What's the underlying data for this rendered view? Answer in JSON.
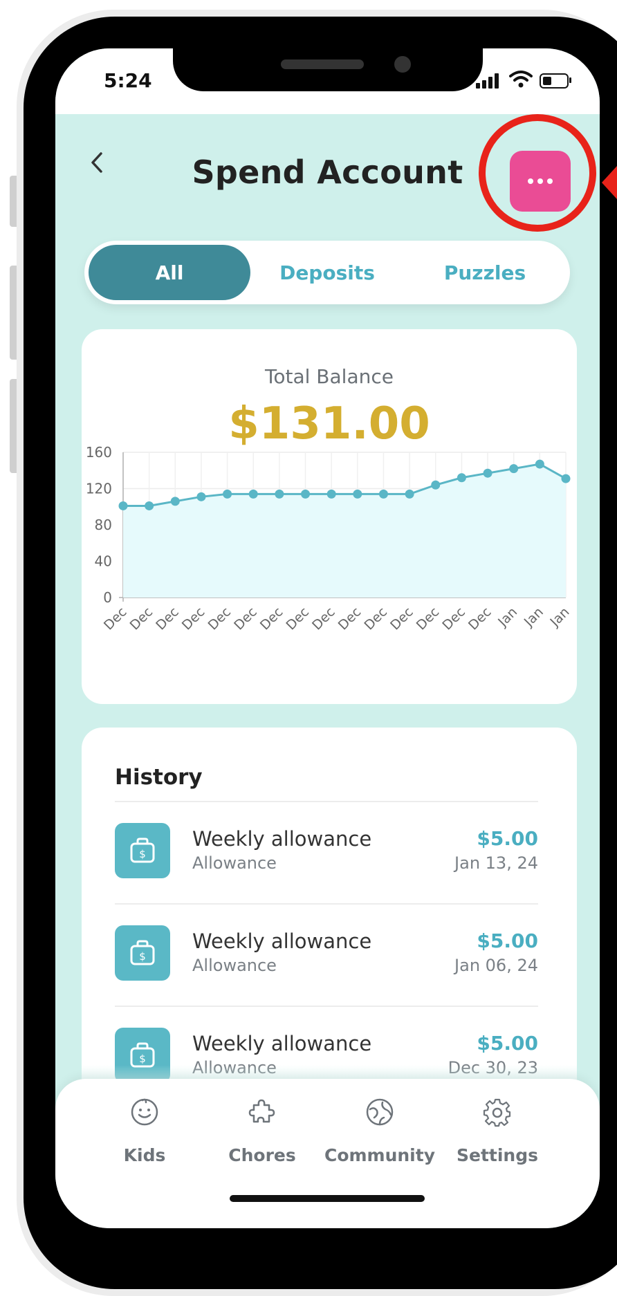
{
  "status": {
    "time": "5:24"
  },
  "header": {
    "title": "Spend Account",
    "back_icon": "chevron-left-icon",
    "more_icon": "ellipsis-icon"
  },
  "filters": {
    "tabs": [
      "All",
      "Deposits",
      "Puzzles"
    ],
    "active": "All"
  },
  "balance": {
    "label": "Total Balance",
    "value": "$131.00"
  },
  "chart_data": {
    "type": "area",
    "x": [
      "Dec",
      "Dec",
      "Dec",
      "Dec",
      "Dec",
      "Dec",
      "Dec",
      "Dec",
      "Dec",
      "Dec",
      "Dec",
      "Dec",
      "Dec",
      "Dec",
      "Dec",
      "Jan",
      "Jan",
      "Jan"
    ],
    "values": [
      101,
      101,
      106,
      111,
      114,
      114,
      114,
      114,
      114,
      114,
      114,
      114,
      124,
      132,
      137,
      142,
      147,
      131
    ],
    "ylim": [
      0,
      160
    ],
    "yticks": [
      0,
      40,
      80,
      120,
      160
    ],
    "grid": true,
    "colors": {
      "line": "#5ab6c6",
      "fill": "#e6fafc",
      "point": "#5ab6c6"
    }
  },
  "history": {
    "title": "History",
    "items": [
      {
        "name": "Weekly allowance",
        "category": "Allowance",
        "amount": "$5.00",
        "date": "Jan 13, 24",
        "icon": "money-bag-icon"
      },
      {
        "name": "Weekly allowance",
        "category": "Allowance",
        "amount": "$5.00",
        "date": "Jan 06, 24",
        "icon": "money-bag-icon"
      },
      {
        "name": "Weekly allowance",
        "category": "Allowance",
        "amount": "$5.00",
        "date": "Dec 30, 23",
        "icon": "money-bag-icon"
      }
    ]
  },
  "tabbar": {
    "items": [
      {
        "label": "Kids",
        "icon": "smiley-face-icon"
      },
      {
        "label": "Chores",
        "icon": "puzzle-piece-icon"
      },
      {
        "label": "Community",
        "icon": "globe-icon"
      },
      {
        "label": "Settings",
        "icon": "gear-icon"
      }
    ]
  },
  "colors": {
    "accent": "#4aaec1",
    "active_tab": "#3f8a98",
    "more_button": "#ea4c95",
    "balance": "#d4ae30",
    "highlight": "#e8231a",
    "background": "#cff0eb"
  }
}
